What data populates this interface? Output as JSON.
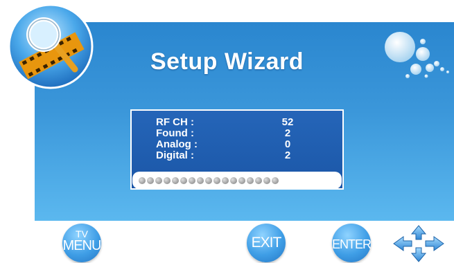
{
  "header": {
    "title": "Setup Wizard"
  },
  "scan": {
    "rows": [
      {
        "label": "RF CH :",
        "value": "52"
      },
      {
        "label": "Found :",
        "value": "2"
      },
      {
        "label": "Analog :",
        "value": "0"
      },
      {
        "label": "Digital :",
        "value": "2"
      }
    ],
    "progress_dots": 17
  },
  "footer": {
    "menu_button": {
      "line1": "TV",
      "line2": "MENU"
    },
    "exit_button": "EXIT",
    "enter_button": "ENTER",
    "nav_icon": "arrow-keys-icon"
  },
  "colors": {
    "panel": "#3b97da",
    "scan_box": "#1f5cae",
    "button": "#3f9ee6"
  }
}
